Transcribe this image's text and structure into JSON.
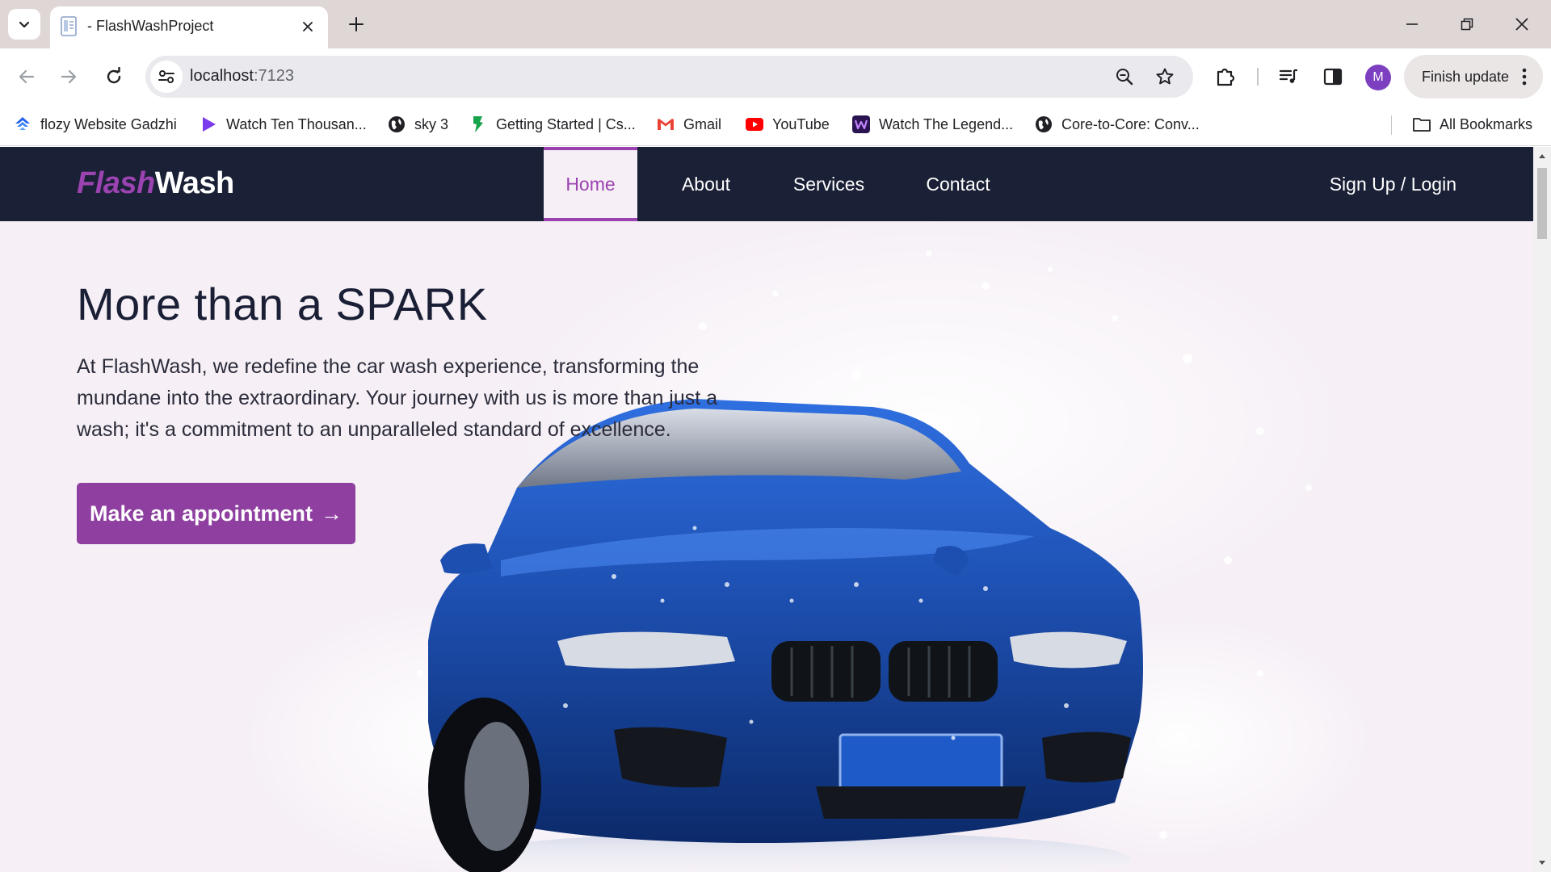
{
  "browser": {
    "tab": {
      "title": "- FlashWashProject"
    },
    "url": {
      "host": "localhost",
      "port": ":7123"
    },
    "finish_update": "Finish update",
    "profile_initial": "M",
    "bookmarks": [
      {
        "label": "flozy Website Gadzhi",
        "icon": "flozy-icon",
        "color": "#2563eb"
      },
      {
        "label": "Watch Ten Thousan...",
        "icon": "play-icon",
        "color": "#7c3aed"
      },
      {
        "label": "sky 3",
        "icon": "globe-icon",
        "color": "#202124"
      },
      {
        "label": "Getting Started | Cs...",
        "icon": "bookmark-green-icon",
        "color": "#16a34a"
      },
      {
        "label": "Gmail",
        "icon": "gmail-icon",
        "color": "#ea4335"
      },
      {
        "label": "YouTube",
        "icon": "youtube-icon",
        "color": "#ff0000"
      },
      {
        "label": "Watch The Legend...",
        "icon": "w-logo-icon",
        "color": "#3b1c6e"
      },
      {
        "label": "Core-to-Core: Conv...",
        "icon": "globe-icon",
        "color": "#202124"
      }
    ],
    "all_bookmarks": "All Bookmarks"
  },
  "site": {
    "brand_part1": "Flash",
    "brand_part2": "Wash",
    "nav": [
      {
        "label": "Home",
        "active": true
      },
      {
        "label": "About",
        "active": false
      },
      {
        "label": "Services",
        "active": false
      },
      {
        "label": "Contact",
        "active": false
      }
    ],
    "signup": "Sign Up / Login"
  },
  "hero": {
    "title": "More than a SPARK",
    "text": "At FlashWash, we redefine the car wash experience, transforming the mundane into the extraordinary. Your journey with us is more than just a wash; it's a commitment to an unparalleled standard of excellence.",
    "cta": "Make an appointment",
    "cta_arrow": "→"
  },
  "colors": {
    "nav_bg": "#1a2035",
    "accent": "#8e3fa0",
    "page_bg": "#f6f0f6",
    "car_blue": "#1d4fb0"
  }
}
